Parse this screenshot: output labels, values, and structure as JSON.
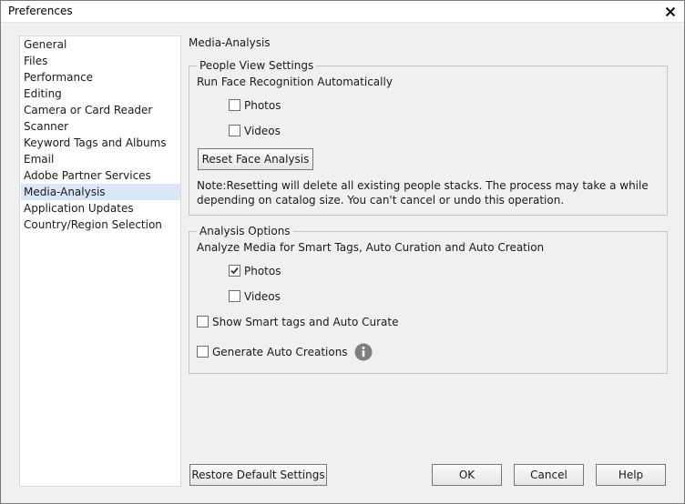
{
  "window": {
    "title": "Preferences",
    "close_icon": "close-icon"
  },
  "sidebar": {
    "selected_index": 10,
    "items": [
      {
        "label": "General"
      },
      {
        "label": "Files"
      },
      {
        "label": "Performance"
      },
      {
        "label": "Editing"
      },
      {
        "label": "Camera or Card Reader"
      },
      {
        "label": "Scanner"
      },
      {
        "label": "Keyword Tags and Albums"
      },
      {
        "label": "Email"
      },
      {
        "label": "Adobe Partner Services"
      },
      {
        "label": "Media-Analysis"
      },
      {
        "label": "Application Updates"
      },
      {
        "label": "Country/Region Selection"
      }
    ]
  },
  "main": {
    "section_title": "Media-Analysis",
    "people_view": {
      "legend": "People View Settings",
      "heading": "Run Face Recognition Automatically",
      "photos": {
        "label": "Photos",
        "checked": false
      },
      "videos": {
        "label": "Videos",
        "checked": false
      },
      "reset_button": "Reset Face Analysis",
      "note_line1": "Note:Resetting will delete all existing people stacks. The process may take a while",
      "note_line2": "depending on catalog size. You can't cancel or undo this operation."
    },
    "analysis": {
      "legend": "Analysis Options",
      "heading": "Analyze Media for Smart Tags, Auto Curation and Auto Creation",
      "photos": {
        "label": "Photos",
        "checked": true
      },
      "videos": {
        "label": "Videos",
        "checked": false
      },
      "smart_tags": {
        "label": "Show Smart tags and Auto Curate",
        "checked": false
      },
      "auto_creations": {
        "label": "Generate Auto Creations",
        "checked": false
      },
      "info_icon": "info-icon"
    }
  },
  "footer": {
    "restore_button": "Restore Default Settings",
    "ok_button": "OK",
    "cancel_button": "Cancel",
    "help_button": "Help"
  },
  "colors": {
    "selection": "#d9e7f6",
    "window_bg": "#f0f0f0",
    "info_icon": "#7f7f7f"
  }
}
